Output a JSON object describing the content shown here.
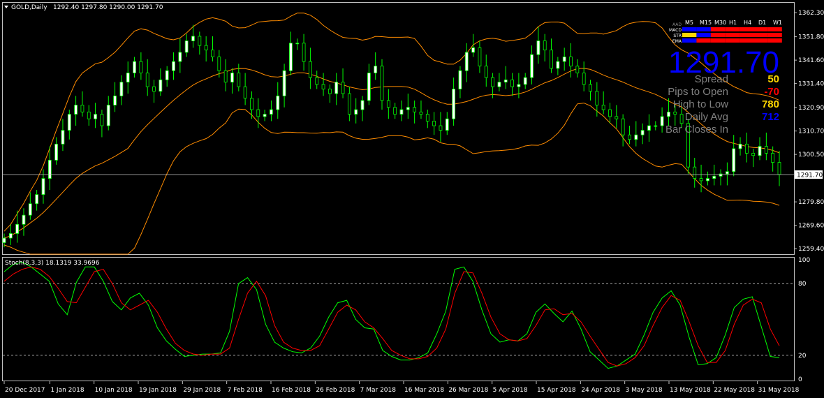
{
  "header": {
    "symbol": "GOLD,Daily",
    "ohlc": "1292.40 1297.80 1290.00 1291.70"
  },
  "stoch_header": "Stoch(8,3,3) 18.1319 33.9696",
  "panel": {
    "timeframes": [
      "M5",
      "M15",
      "M30",
      "H1",
      "H4",
      "D1",
      "W1"
    ],
    "rows": [
      {
        "label": "AAD",
        "cells": [
          "",
          "",
          "",
          "",
          "",
          "",
          ""
        ]
      },
      {
        "label": "MACD",
        "cells": [
          "blue",
          "blue",
          "red",
          "red",
          "red",
          "red",
          "red"
        ]
      },
      {
        "label": "STR",
        "cells": [
          "yellow",
          "blue",
          "red",
          "red",
          "red",
          "red",
          "red"
        ]
      },
      {
        "label": "EMA",
        "cells": [
          "blue",
          "red",
          "red",
          "red",
          "red",
          "red",
          "red"
        ]
      }
    ],
    "price": "1291.70",
    "stats": [
      {
        "label": "Spread",
        "value": "50",
        "color": "#ffd700"
      },
      {
        "label": "Pips to Open",
        "value": "-70",
        "color": "#ff0000"
      },
      {
        "label": "High to Low",
        "value": "780",
        "color": "#ffd700"
      },
      {
        "label": "Daily Avg",
        "value": "712",
        "color": "#0000ff"
      },
      {
        "label": "Bar Closes In",
        "value": "",
        "color": "#ffffff"
      }
    ]
  },
  "colors": {
    "bull": "#ffffff",
    "bear": "#000000",
    "wick": "#00ff00",
    "band": "#ff8c00",
    "stoch_main": "#00ff00",
    "stoch_signal": "#ff0000",
    "current_line": "#c0c0c0"
  },
  "chart_data": [
    {
      "type": "candlestick",
      "title": "GOLD,Daily",
      "ylim": [
        1257.0,
        1366.6
      ],
      "y_ticks": [
        1362.3,
        1351.8,
        1341.6,
        1331.4,
        1320.9,
        1310.7,
        1300.5,
        1290.0,
        1279.8,
        1269.6,
        1259.4
      ],
      "current_price": 1291.7,
      "x_labels": [
        "20 Dec 2017",
        "1 Jan 2018",
        "10 Jan 2018",
        "19 Jan 2018",
        "29 Jan 2018",
        "7 Feb 2018",
        "16 Feb 2018",
        "26 Feb 2018",
        "7 Mar 2018",
        "16 Mar 2018",
        "26 Mar 2018",
        "5 Apr 2018",
        "15 Apr 2018",
        "24 Apr 2018",
        "3 May 2018",
        "13 May 2018",
        "22 May 2018",
        "31 May 2018"
      ],
      "bollinger": {
        "upper": [],
        "middle": [],
        "lower": []
      },
      "close_path": [
        1264,
        1266,
        1270,
        1274,
        1279,
        1283,
        1290,
        1298,
        1305,
        1311,
        1318,
        1322,
        1319,
        1316,
        1318,
        1313,
        1322,
        1326,
        1332,
        1336,
        1341,
        1336,
        1330,
        1328,
        1333,
        1337,
        1341,
        1345,
        1350,
        1352,
        1348,
        1346,
        1343,
        1337,
        1332,
        1336,
        1330,
        1325,
        1320,
        1317,
        1318,
        1320,
        1326,
        1337,
        1349,
        1349,
        1341,
        1334,
        1331,
        1329,
        1327,
        1332,
        1327,
        1318,
        1320,
        1324,
        1336,
        1339,
        1324,
        1321,
        1318,
        1320,
        1321,
        1319,
        1318,
        1315,
        1313,
        1311,
        1316,
        1329,
        1337,
        1345,
        1347,
        1339,
        1334,
        1330,
        1332,
        1333,
        1330,
        1331,
        1334,
        1344,
        1350,
        1346,
        1338,
        1341,
        1343,
        1339,
        1336,
        1331,
        1328,
        1322,
        1320,
        1317,
        1316,
        1309,
        1307,
        1309,
        1311,
        1313,
        1313,
        1317,
        1319,
        1318,
        1314,
        1295,
        1290,
        1289,
        1290,
        1291,
        1292,
        1293,
        1303,
        1305,
        1301,
        1300,
        1304,
        1301,
        1297,
        1291.7
      ]
    },
    {
      "type": "line",
      "title": "Stoch(8,3,3)",
      "ylim": [
        0,
        100
      ],
      "y_ticks": [
        100,
        80,
        20,
        0
      ],
      "levels": [
        80,
        20
      ],
      "series": [
        {
          "name": "main",
          "values": [
            90,
            96,
            98,
            94,
            88,
            82,
            63,
            54,
            81,
            94,
            94,
            82,
            65,
            58,
            68,
            72,
            62,
            43,
            32,
            25,
            19,
            20,
            21,
            21,
            22,
            40,
            80,
            85,
            75,
            46,
            31,
            26,
            23,
            22,
            26,
            36,
            52,
            64,
            66,
            50,
            43,
            42,
            24,
            19,
            16,
            16,
            18,
            22,
            38,
            57,
            92,
            94,
            82,
            58,
            38,
            31,
            33,
            32,
            38,
            56,
            63,
            55,
            48,
            57,
            42,
            23,
            16,
            9,
            11,
            16,
            21,
            37,
            56,
            68,
            74,
            62,
            35,
            12,
            13,
            18,
            37,
            60,
            67,
            69,
            44,
            19,
            18
          ]
        },
        {
          "name": "signal",
          "values": [
            82,
            88,
            92,
            94,
            92,
            86,
            76,
            65,
            64,
            77,
            90,
            92,
            80,
            64,
            58,
            62,
            66,
            56,
            42,
            30,
            24,
            21,
            20,
            21,
            21,
            26,
            50,
            72,
            82,
            70,
            45,
            31,
            26,
            24,
            24,
            28,
            42,
            56,
            62,
            58,
            48,
            43,
            34,
            24,
            20,
            17,
            17,
            19,
            26,
            42,
            72,
            90,
            89,
            72,
            52,
            38,
            33,
            32,
            34,
            45,
            58,
            59,
            54,
            55,
            48,
            36,
            25,
            14,
            11,
            13,
            18,
            28,
            45,
            60,
            70,
            66,
            48,
            28,
            14,
            14,
            24,
            46,
            62,
            67,
            64,
            42,
            28
          ]
        }
      ]
    }
  ]
}
